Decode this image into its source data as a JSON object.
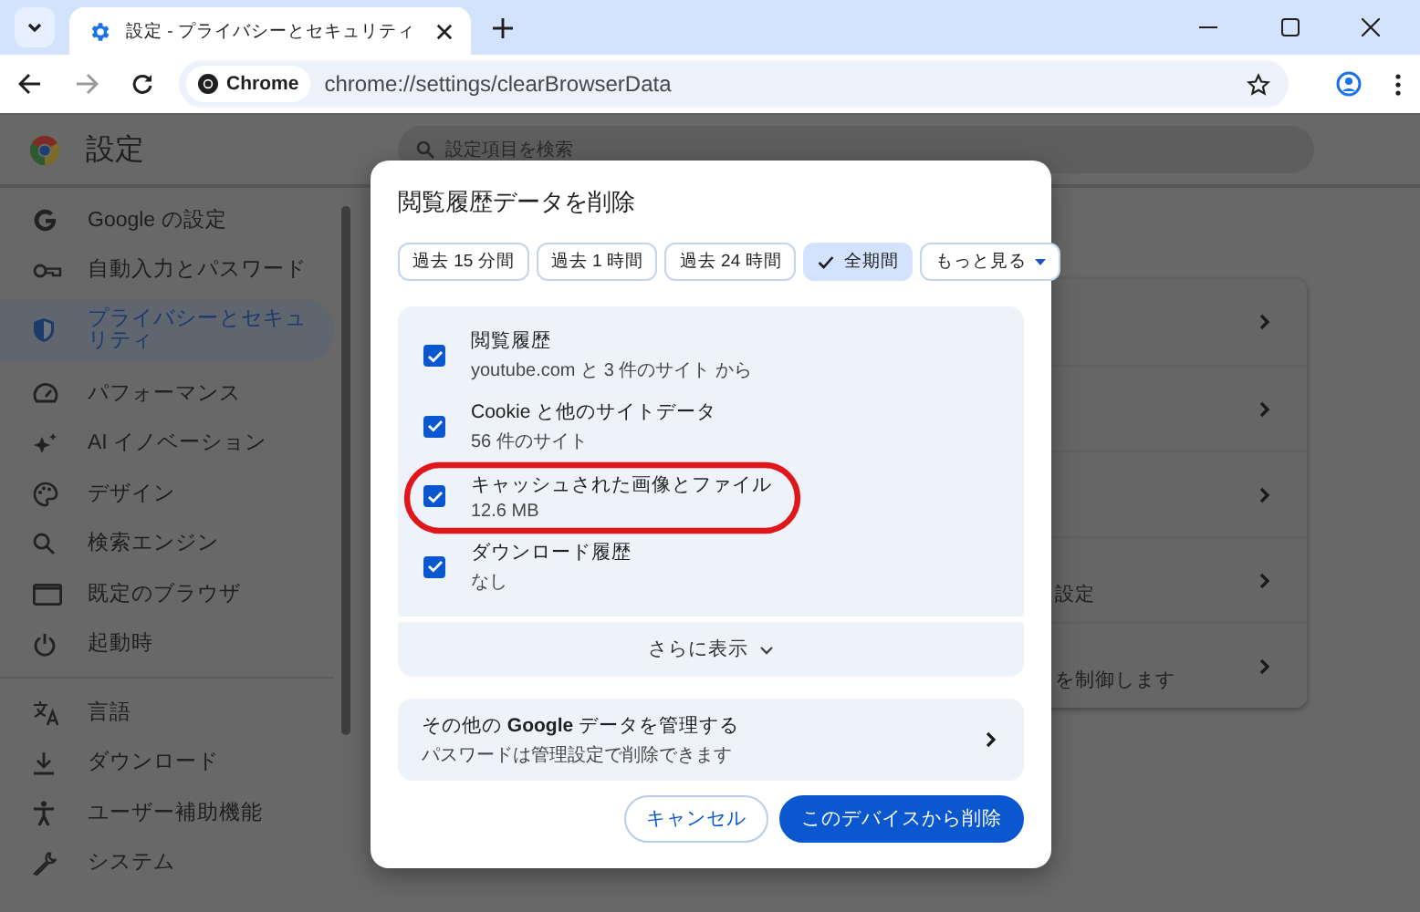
{
  "browser": {
    "tab_title": "設定 - プライバシーとセキュリティ",
    "chip_label": "Chrome",
    "url": "chrome://settings/clearBrowserData"
  },
  "settings": {
    "title": "設定",
    "search": {
      "placeholder": "設定項目を検索"
    },
    "sidebar": {
      "groups": [
        [
          {
            "label": "Google の設定",
            "selected": false
          },
          {
            "label": "自動入力とパスワード",
            "selected": false
          },
          {
            "label": "プライバシーとセキュリティ",
            "selected": true
          },
          {
            "label": "パフォーマンス",
            "selected": false
          },
          {
            "label": "AI イノベーション",
            "selected": false
          },
          {
            "label": "デザイン",
            "selected": false
          },
          {
            "label": "検索エンジン",
            "selected": false
          },
          {
            "label": "既定のブラウザ",
            "selected": false
          },
          {
            "label": "起動時",
            "selected": false
          }
        ],
        [
          {
            "label": "言語",
            "selected": false
          },
          {
            "label": "ダウンロード",
            "selected": false
          },
          {
            "label": "ユーザー補助機能",
            "selected": false
          },
          {
            "label": "システム",
            "selected": false
          }
        ]
      ]
    },
    "card_rows": [
      {
        "kind": "plain"
      },
      {
        "kind": "plain"
      },
      {
        "kind": "plain"
      },
      {
        "kind": "detail",
        "text": "設定"
      },
      {
        "kind": "detail",
        "text": "を制御します"
      }
    ]
  },
  "dialog": {
    "title": "閲覧履歴データを削除",
    "time_ranges": [
      {
        "label": "過去 15 分間",
        "selected": false,
        "kind": "option"
      },
      {
        "label": "過去 1 時間",
        "selected": false,
        "kind": "option"
      },
      {
        "label": "過去 24 時間",
        "selected": false,
        "kind": "option"
      },
      {
        "label": "全期間",
        "selected": true,
        "kind": "option"
      },
      {
        "label": "もっと見る",
        "selected": false,
        "kind": "dropdown"
      }
    ],
    "items": [
      {
        "title": "閲覧履歴",
        "detail": "youtube.com と 3 件のサイト から",
        "checked": true,
        "highlighted": false
      },
      {
        "title": "Cookie と他のサイトデータ",
        "detail": "56 件のサイト",
        "checked": true,
        "highlighted": false
      },
      {
        "title": "キャッシュされた画像とファイル",
        "detail": "12.6 MB",
        "checked": true,
        "highlighted": true
      },
      {
        "title": "ダウンロード履歴",
        "detail": "なし",
        "checked": true,
        "highlighted": false
      }
    ],
    "more_button": "さらに表示",
    "google_data": {
      "title": "その他の **Google** データを管理する",
      "detail": "パスワードは管理設定で削除できます"
    },
    "buttons": [
      {
        "label": "キャンセル",
        "kind": "secondary"
      },
      {
        "label": "このデバイスから削除",
        "kind": "primary"
      }
    ]
  }
}
